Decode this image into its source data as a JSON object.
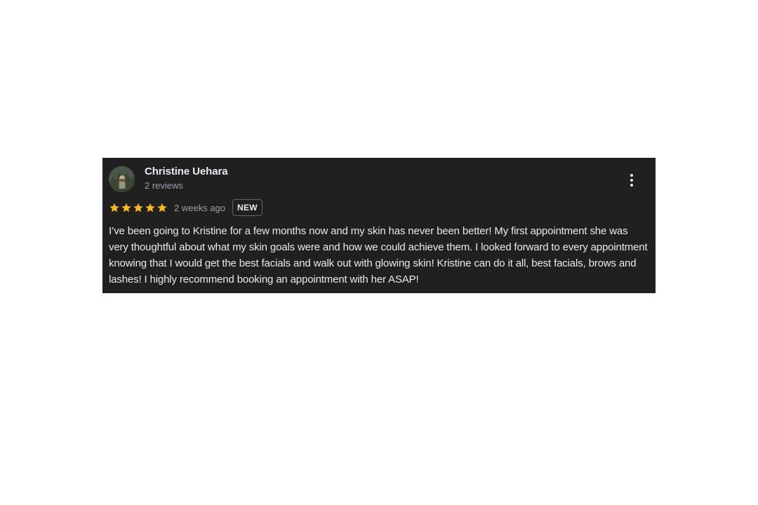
{
  "review": {
    "author": {
      "name": "Christine Uehara",
      "review_count": "2 reviews",
      "avatar_icon": "profile-photo"
    },
    "rating": {
      "stars": 5,
      "max_stars": 5,
      "star_color": "#fbbc04"
    },
    "time": "2 weeks ago",
    "badge": "NEW",
    "text": "I’ve been going to Kristine for a few months now and my skin has never been better! My first appointment she was very thoughtful about what my skin goals were and how we could achieve them. I looked forward to every appointment knowing that I would get the best facials and walk out with glowing skin! Kristine can do it all, best facials, brows and lashes! I highly recommend booking an appointment with her ASAP!",
    "more_icon": "more-vert-icon"
  },
  "colors": {
    "card_background": "#202020",
    "page_background": "#ffffff"
  }
}
